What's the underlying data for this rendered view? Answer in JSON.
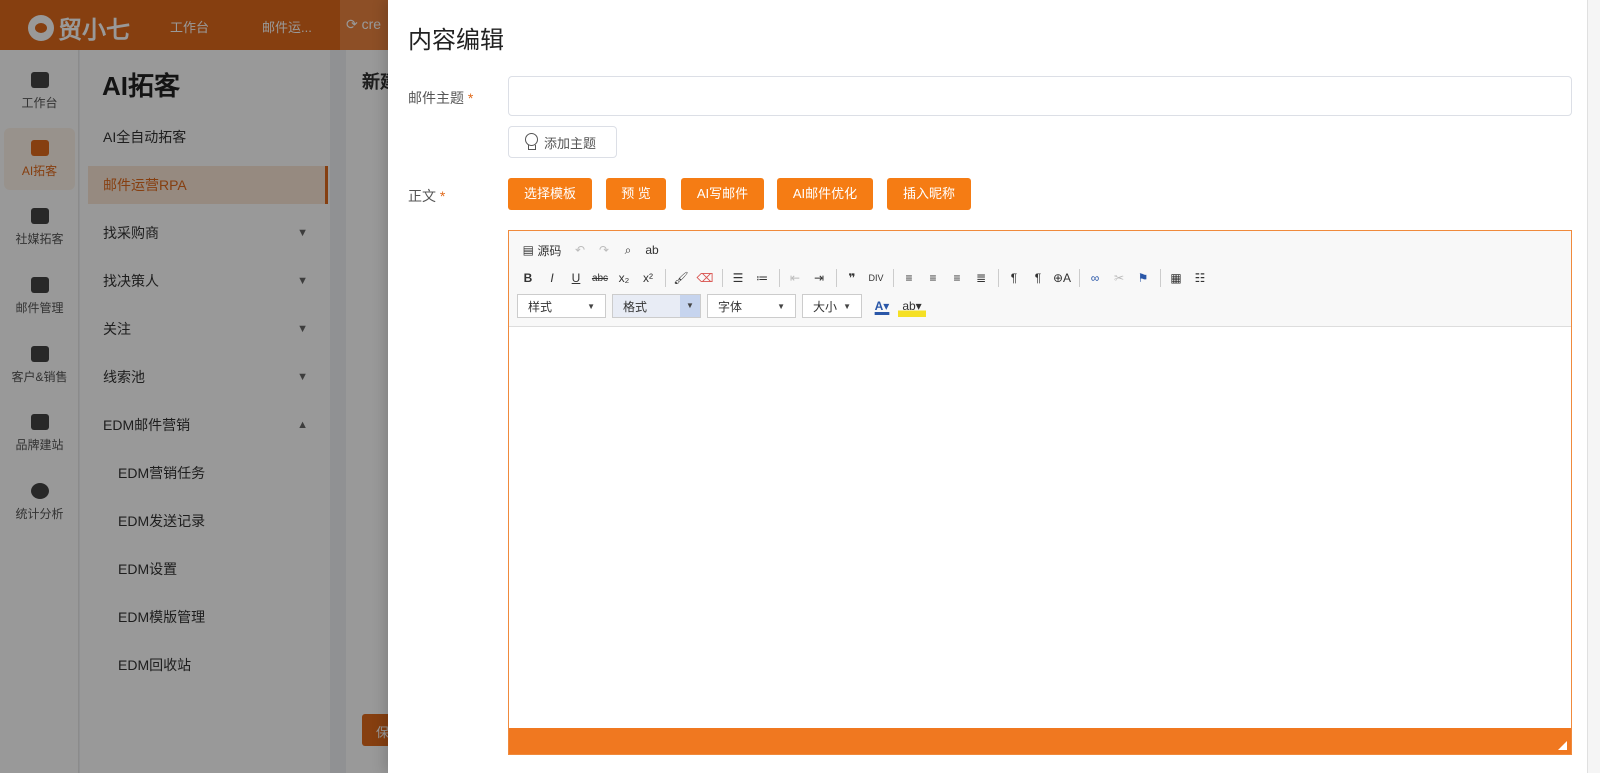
{
  "app": {
    "logo_text": "贸小七",
    "topnav": [
      "工作台",
      "邮件运...",
      "cre"
    ]
  },
  "iconrail": {
    "items": [
      {
        "label": "工作台",
        "icon": "monitor-icon"
      },
      {
        "label": "AI拓客",
        "icon": "robot-icon",
        "active": true
      },
      {
        "label": "社媒拓客",
        "icon": "people-icon"
      },
      {
        "label": "邮件管理",
        "icon": "mail-icon"
      },
      {
        "label": "客户&销售",
        "icon": "customer-icon"
      },
      {
        "label": "品牌建站",
        "icon": "chart-line-icon"
      },
      {
        "label": "统计分析",
        "icon": "pie-chart-icon"
      }
    ]
  },
  "submenu": {
    "title": "AI拓客",
    "items": [
      {
        "label": "AI全自动拓客"
      },
      {
        "label": "邮件运营RPA",
        "active": true
      },
      {
        "label": "找采购商",
        "chevron": "down"
      },
      {
        "label": "找决策人",
        "chevron": "down"
      },
      {
        "label": "关注",
        "chevron": "down"
      },
      {
        "label": "线索池",
        "chevron": "down"
      },
      {
        "label": "EDM邮件营销",
        "chevron": "up"
      },
      {
        "label": "EDM营销任务",
        "sub": true
      },
      {
        "label": "EDM发送记录",
        "sub": true
      },
      {
        "label": "EDM设置",
        "sub": true
      },
      {
        "label": "EDM模版管理",
        "sub": true
      },
      {
        "label": "EDM回收站",
        "sub": true
      }
    ]
  },
  "main": {
    "heading": "新建",
    "button": "保"
  },
  "drawer": {
    "title": "内容编辑",
    "subject_label": "邮件主题",
    "required_mark": "*",
    "subject_value": "",
    "add_subject": "添加主题",
    "body_label": "正文",
    "actions": [
      "选择模板",
      "预 览",
      "AI写邮件",
      "AI邮件优化",
      "插入昵称"
    ]
  },
  "editor": {
    "row1": [
      "源码",
      "撤销",
      "重做",
      "查找",
      "拼写"
    ],
    "combos": {
      "style": "样式",
      "format": "格式",
      "font": "字体",
      "size": "大小"
    },
    "accent_color": "#f07820"
  }
}
